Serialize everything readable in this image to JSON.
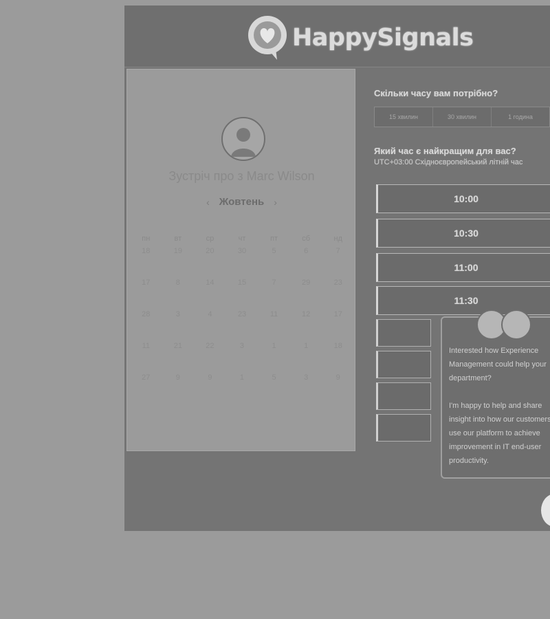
{
  "brand": {
    "name": "HappySignals",
    "colors": {
      "header_bg": "#6f6f6f",
      "panel_bg": "#9b9b9b",
      "app_bg": "#747474",
      "text_light": "#d8d8d8"
    }
  },
  "calendar": {
    "title": "Зустріч про з Marc Wilson",
    "month": "Жовтень",
    "prev_icon": "‹",
    "next_icon": "›",
    "weekdays": [
      "пн",
      "вт",
      "ср",
      "чт",
      "пт",
      "сб",
      "нд"
    ],
    "days": [
      [
        "18",
        "19",
        "20",
        "30",
        "5",
        "6",
        "7"
      ],
      [
        "17",
        "8",
        "14",
        "15",
        "7",
        "29",
        "23"
      ],
      [
        "28",
        "3",
        "4",
        "23",
        "11",
        "12",
        "17"
      ],
      [
        "11",
        "21",
        "22",
        "3",
        "1",
        "1",
        "18"
      ],
      [
        "27",
        "9",
        "9",
        "1",
        "5",
        "3",
        "9"
      ]
    ]
  },
  "booking": {
    "duration_question": "Скільки часу вам потрібно?",
    "duration_options": [
      "15 хвилин",
      "30 хвилин",
      "1 година"
    ],
    "time_question": "Який час є найкращим для вас?",
    "time_subtitle": "UTC+03:00 Східноєвропейський літній час",
    "slots": [
      "10:00",
      "10:30",
      "11:00",
      "11:30"
    ]
  },
  "chat": {
    "message_1": [
      "Interested how Experience",
      "Management could help your",
      "department?"
    ],
    "message_2": [
      "I'm happy to help and share",
      "insight into how our customers",
      "use our platform to achieve",
      "improvement in IT end-user",
      "productivity."
    ]
  }
}
